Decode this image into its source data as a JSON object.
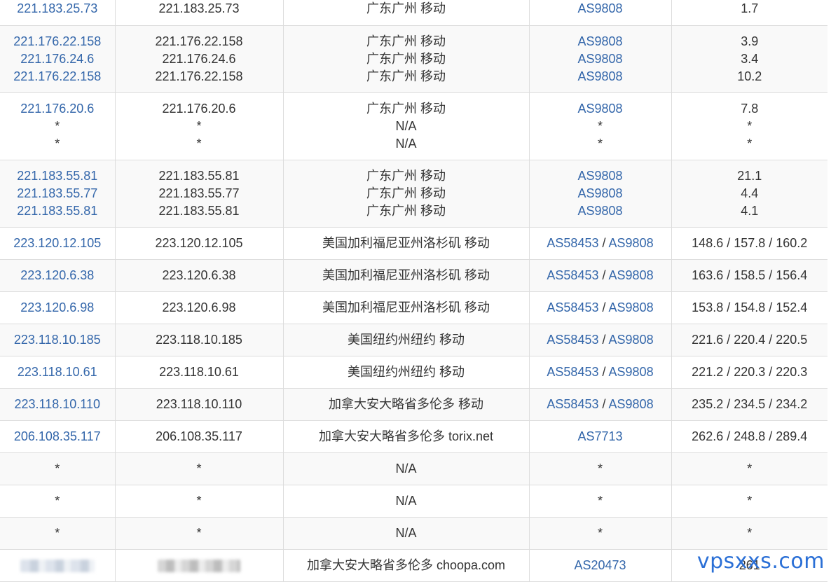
{
  "rows": [
    {
      "ip": [
        "221.183.25.73"
      ],
      "host": [
        "221.183.25.73"
      ],
      "geo": [
        "广东广州 移动"
      ],
      "asn": [
        [
          "AS9808"
        ]
      ],
      "latency": [
        "1.7"
      ]
    },
    {
      "ip": [
        "221.176.22.158",
        "221.176.24.6",
        "221.176.22.158"
      ],
      "host": [
        "221.176.22.158",
        "221.176.24.6",
        "221.176.22.158"
      ],
      "geo": [
        "广东广州 移动",
        "广东广州 移动",
        "广东广州 移动"
      ],
      "asn": [
        [
          "AS9808"
        ],
        [
          "AS9808"
        ],
        [
          "AS9808"
        ]
      ],
      "latency": [
        "3.9",
        "3.4",
        "10.2"
      ]
    },
    {
      "ip": [
        "221.176.20.6",
        "*",
        "*"
      ],
      "host": [
        "221.176.20.6",
        "*",
        "*"
      ],
      "geo": [
        "广东广州 移动",
        "N/A",
        "N/A"
      ],
      "asn": [
        [
          "AS9808"
        ],
        [
          "*"
        ],
        [
          "*"
        ]
      ],
      "latency": [
        "7.8",
        "*",
        "*"
      ]
    },
    {
      "ip": [
        "221.183.55.81",
        "221.183.55.77",
        "221.183.55.81"
      ],
      "host": [
        "221.183.55.81",
        "221.183.55.77",
        "221.183.55.81"
      ],
      "geo": [
        "广东广州 移动",
        "广东广州 移动",
        "广东广州 移动"
      ],
      "asn": [
        [
          "AS9808"
        ],
        [
          "AS9808"
        ],
        [
          "AS9808"
        ]
      ],
      "latency": [
        "21.1",
        "4.4",
        "4.1"
      ]
    },
    {
      "ip": [
        "223.120.12.105"
      ],
      "host": [
        "223.120.12.105"
      ],
      "geo": [
        "美国加利福尼亚州洛杉矶 移动"
      ],
      "asn": [
        [
          "AS58453",
          "AS9808"
        ]
      ],
      "latency": [
        "148.6 / 157.8 / 160.2"
      ]
    },
    {
      "ip": [
        "223.120.6.38"
      ],
      "host": [
        "223.120.6.38"
      ],
      "geo": [
        "美国加利福尼亚州洛杉矶 移动"
      ],
      "asn": [
        [
          "AS58453",
          "AS9808"
        ]
      ],
      "latency": [
        "163.6 / 158.5 / 156.4"
      ]
    },
    {
      "ip": [
        "223.120.6.98"
      ],
      "host": [
        "223.120.6.98"
      ],
      "geo": [
        "美国加利福尼亚州洛杉矶 移动"
      ],
      "asn": [
        [
          "AS58453",
          "AS9808"
        ]
      ],
      "latency": [
        "153.8 / 154.8 / 152.4"
      ]
    },
    {
      "ip": [
        "223.118.10.185"
      ],
      "host": [
        "223.118.10.185"
      ],
      "geo": [
        "美国纽约州纽约 移动"
      ],
      "asn": [
        [
          "AS58453",
          "AS9808"
        ]
      ],
      "latency": [
        "221.6 / 220.4 / 220.5"
      ]
    },
    {
      "ip": [
        "223.118.10.61"
      ],
      "host": [
        "223.118.10.61"
      ],
      "geo": [
        "美国纽约州纽约 移动"
      ],
      "asn": [
        [
          "AS58453",
          "AS9808"
        ]
      ],
      "latency": [
        "221.2 / 220.3 / 220.3"
      ]
    },
    {
      "ip": [
        "223.118.10.110"
      ],
      "host": [
        "223.118.10.110"
      ],
      "geo": [
        "加拿大安大略省多伦多 移动"
      ],
      "asn": [
        [
          "AS58453",
          "AS9808"
        ]
      ],
      "latency": [
        "235.2 / 234.5 / 234.2"
      ]
    },
    {
      "ip": [
        "206.108.35.117"
      ],
      "host": [
        "206.108.35.117"
      ],
      "geo": [
        "加拿大安大略省多伦多 torix.net"
      ],
      "asn": [
        [
          "AS7713"
        ]
      ],
      "latency": [
        "262.6 / 248.8 / 289.4"
      ]
    },
    {
      "ip": [
        "*"
      ],
      "host": [
        "*"
      ],
      "geo": [
        "N/A"
      ],
      "asn": [
        [
          "*"
        ]
      ],
      "latency": [
        "*"
      ]
    },
    {
      "ip": [
        "*"
      ],
      "host": [
        "*"
      ],
      "geo": [
        "N/A"
      ],
      "asn": [
        [
          "*"
        ]
      ],
      "latency": [
        "*"
      ]
    },
    {
      "ip": [
        "*"
      ],
      "host": [
        "*"
      ],
      "geo": [
        "N/A"
      ],
      "asn": [
        [
          "*"
        ]
      ],
      "latency": [
        "*"
      ]
    },
    {
      "ip": [
        "@blurred"
      ],
      "host": [
        "@blurred"
      ],
      "geo": [
        "加拿大安大略省多伦多 choopa.com"
      ],
      "asn": [
        [
          "AS20473"
        ]
      ],
      "latency": [
        "261"
      ]
    }
  ],
  "asn_separator": "/",
  "watermark": "vpsxxs.com",
  "colors": {
    "link": "#3366aa",
    "text": "#333333",
    "stripe": "#f9f9f9",
    "border": "#dddddd",
    "watermark": "#2a6fd6"
  }
}
